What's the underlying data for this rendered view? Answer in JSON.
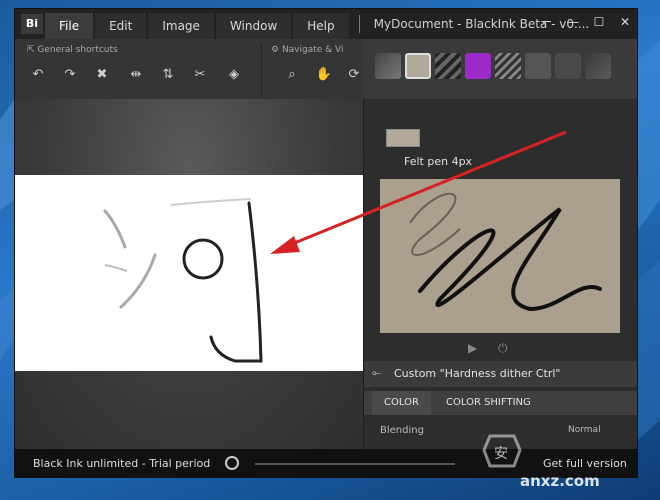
{
  "menu": {
    "logo": "Bi",
    "tabs": [
      "File",
      "Edit",
      "Image",
      "Window",
      "Help"
    ],
    "active_tab": "File",
    "document_title": "MyDocument - BlackInk Beta - v0...."
  },
  "toolbar": {
    "group_general": "General shortcuts",
    "group_navigate": "Navigate & Vi"
  },
  "brush_panel": {
    "brush_name": "Felt pen 4px",
    "custom_label": "Custom \"Hardness dither Ctrl\"",
    "tabs": [
      "COLOR",
      "COLOR SHIFTING"
    ],
    "blending_label": "Blending",
    "blending_value": "Normal"
  },
  "statusbar": {
    "trial_text": "Black Ink unlimited - Trial period",
    "upgrade_link": "Get full version"
  },
  "watermark": {
    "site": "anxz.com"
  },
  "colors": {
    "annotation_arrow": "#d62222",
    "brush_accent": "#9b2bc7"
  }
}
